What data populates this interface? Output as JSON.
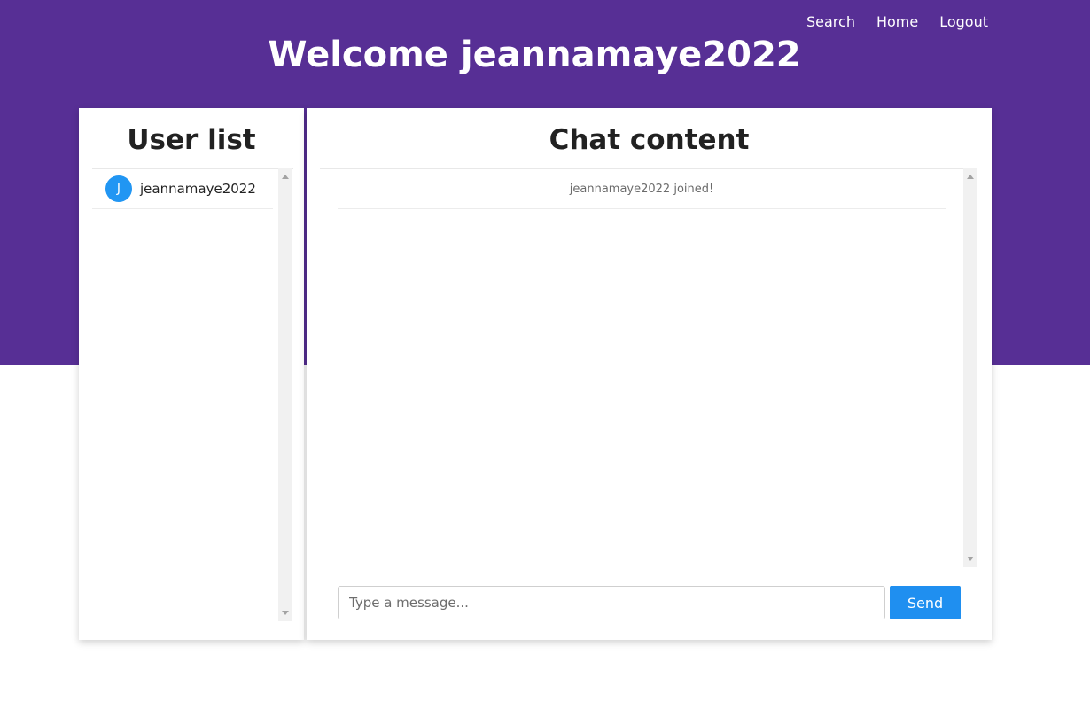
{
  "nav": {
    "search": "Search",
    "home": "Home",
    "logout": "Logout"
  },
  "header": {
    "welcome": "Welcome jeannamaye2022"
  },
  "users_panel": {
    "title": "User list",
    "users": [
      {
        "initial": "J",
        "name": "jeannamaye2022"
      }
    ]
  },
  "chat_panel": {
    "title": "Chat content",
    "messages": [
      {
        "text": "jeannamaye2022 joined!"
      }
    ]
  },
  "composer": {
    "placeholder": "Type a message...",
    "send_label": "Send"
  },
  "colors": {
    "header_bg": "#572f95",
    "accent": "#1f8ff0",
    "avatar": "#2196f3"
  }
}
